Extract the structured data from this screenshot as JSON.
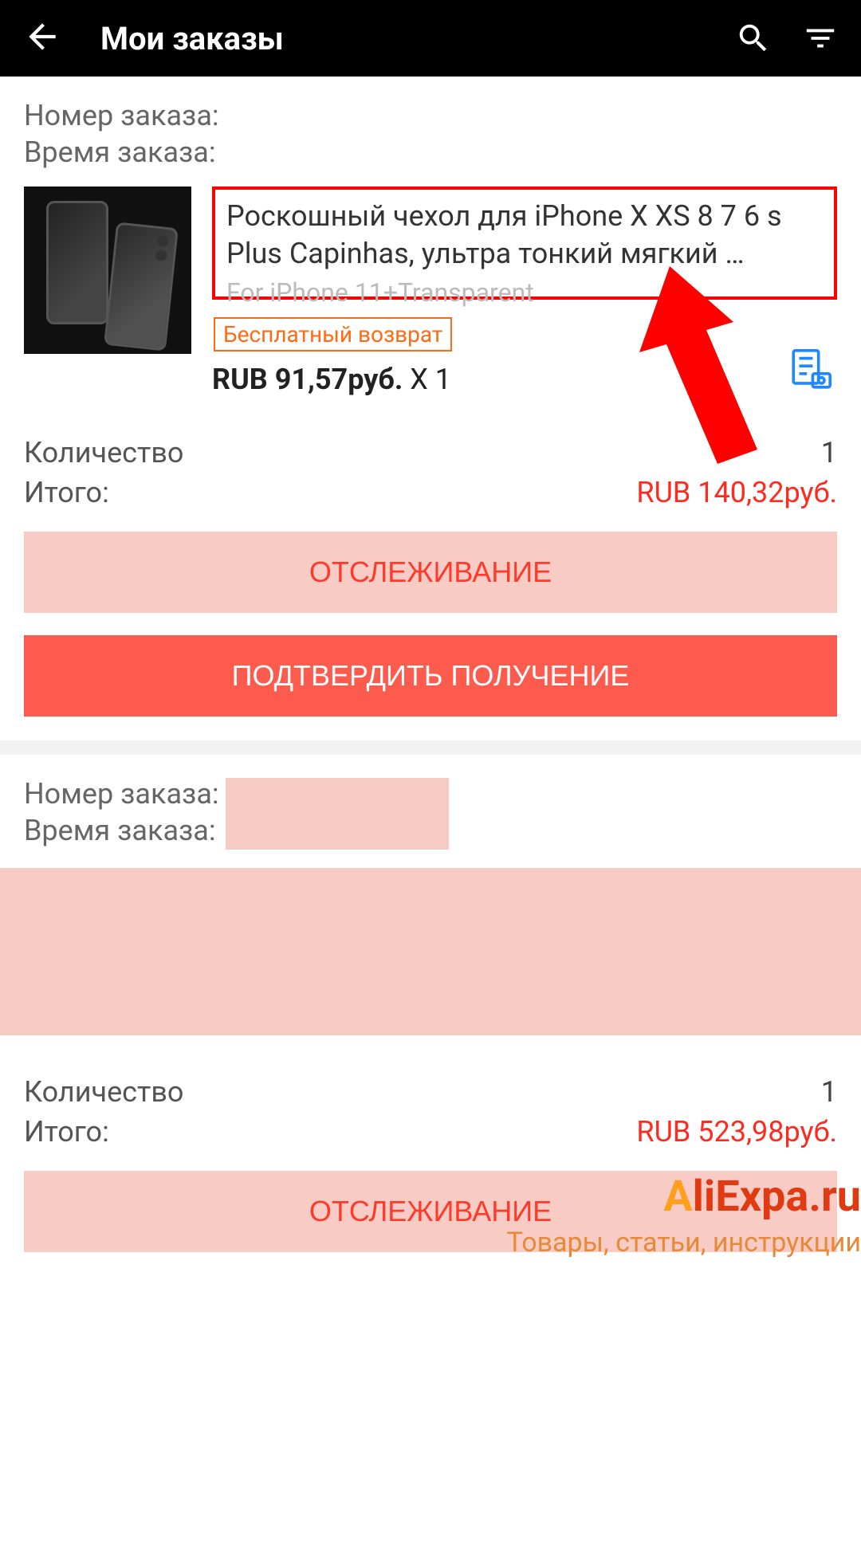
{
  "header": {
    "title": "Мои заказы"
  },
  "order1": {
    "order_number_label": "Номер заказа:",
    "order_time_label": "Время заказа:",
    "product_title": "Роскошный чехол для iPhone X XS 8 7 6 s Plus Capinhas, ультра тонкий мягкий …",
    "variant": "For iPhone 11+Transparent",
    "free_return": "Бесплатный возврат",
    "price_prefix": "RUB 91,57руб.",
    "price_qty": " X 1",
    "qty_label": "Количество",
    "qty_value": "1",
    "total_label": "Итого:",
    "total_value": "RUB 140,32руб.",
    "track_button": "ОТСЛЕЖИВАНИЕ",
    "confirm_button": "ПОДТВЕРДИТЬ ПОЛУЧЕНИЕ"
  },
  "order2": {
    "order_number_label": "Номер заказа:",
    "order_time_label": "Время заказа:",
    "qty_label": "Количество",
    "qty_value": "1",
    "total_label": "Итого:",
    "total_value": "RUB 523,98руб.",
    "track_button": "ОТСЛЕЖИВАНИЕ"
  },
  "watermark": {
    "brand_first": "A",
    "brand_rest": "liExpa.ru",
    "tagline": "Товары, статьи, инструкции"
  }
}
